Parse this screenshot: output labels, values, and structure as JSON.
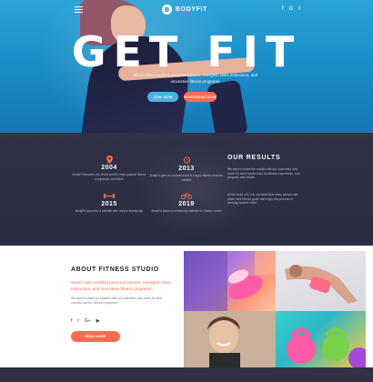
{
  "header": {
    "brand_logo_letter": "B",
    "brand": "BODYFIT",
    "social": [
      "f",
      "G",
      "t"
    ]
  },
  "hero": {
    "title": "GET FIT",
    "subtitle": "World class certified personal trainers, energetic class instructors, and innovative fitness programs.",
    "btn_join": "JOIN NOW",
    "btn_purchase": "PURCHASE NOW"
  },
  "history": {
    "milestones": [
      {
        "year": "2004",
        "text": "BodyFit became one of the world's most popular fitness companies worldwide"
      },
      {
        "year": "2013",
        "text": "BodyFit gets an innovation for a unique fitness services website"
      },
      {
        "year": "2015",
        "text": "BodyFit launched a website with unique fitness tips"
      },
      {
        "year": "2019",
        "text": "BodyFit starts a community website for fitness lovers"
      }
    ],
    "results_title": "OUR RESULTS",
    "results_p1": "We want to share the results with our customers who come for well-rounded and fun fitness experience, real progress and results.",
    "results_p2": "At the heart of it, it is our belief that every person can reach their fitness goals and enjoy the process of working towards them."
  },
  "about": {
    "title": "ABOUT FITNESS STUDIO",
    "lead": "World class certified personal trainers, energetic class instructors, and innovative fitness programs.",
    "body": "We want to share our passion with our customers who come for well-rounded and fun fitness experience.",
    "social": [
      "f",
      "t",
      "G+",
      "▶"
    ],
    "button": "READ MORE"
  },
  "colors": {
    "accent": "#ff6b4e",
    "hero_blue": "#1c8fc8",
    "dark": "#2f3147"
  }
}
